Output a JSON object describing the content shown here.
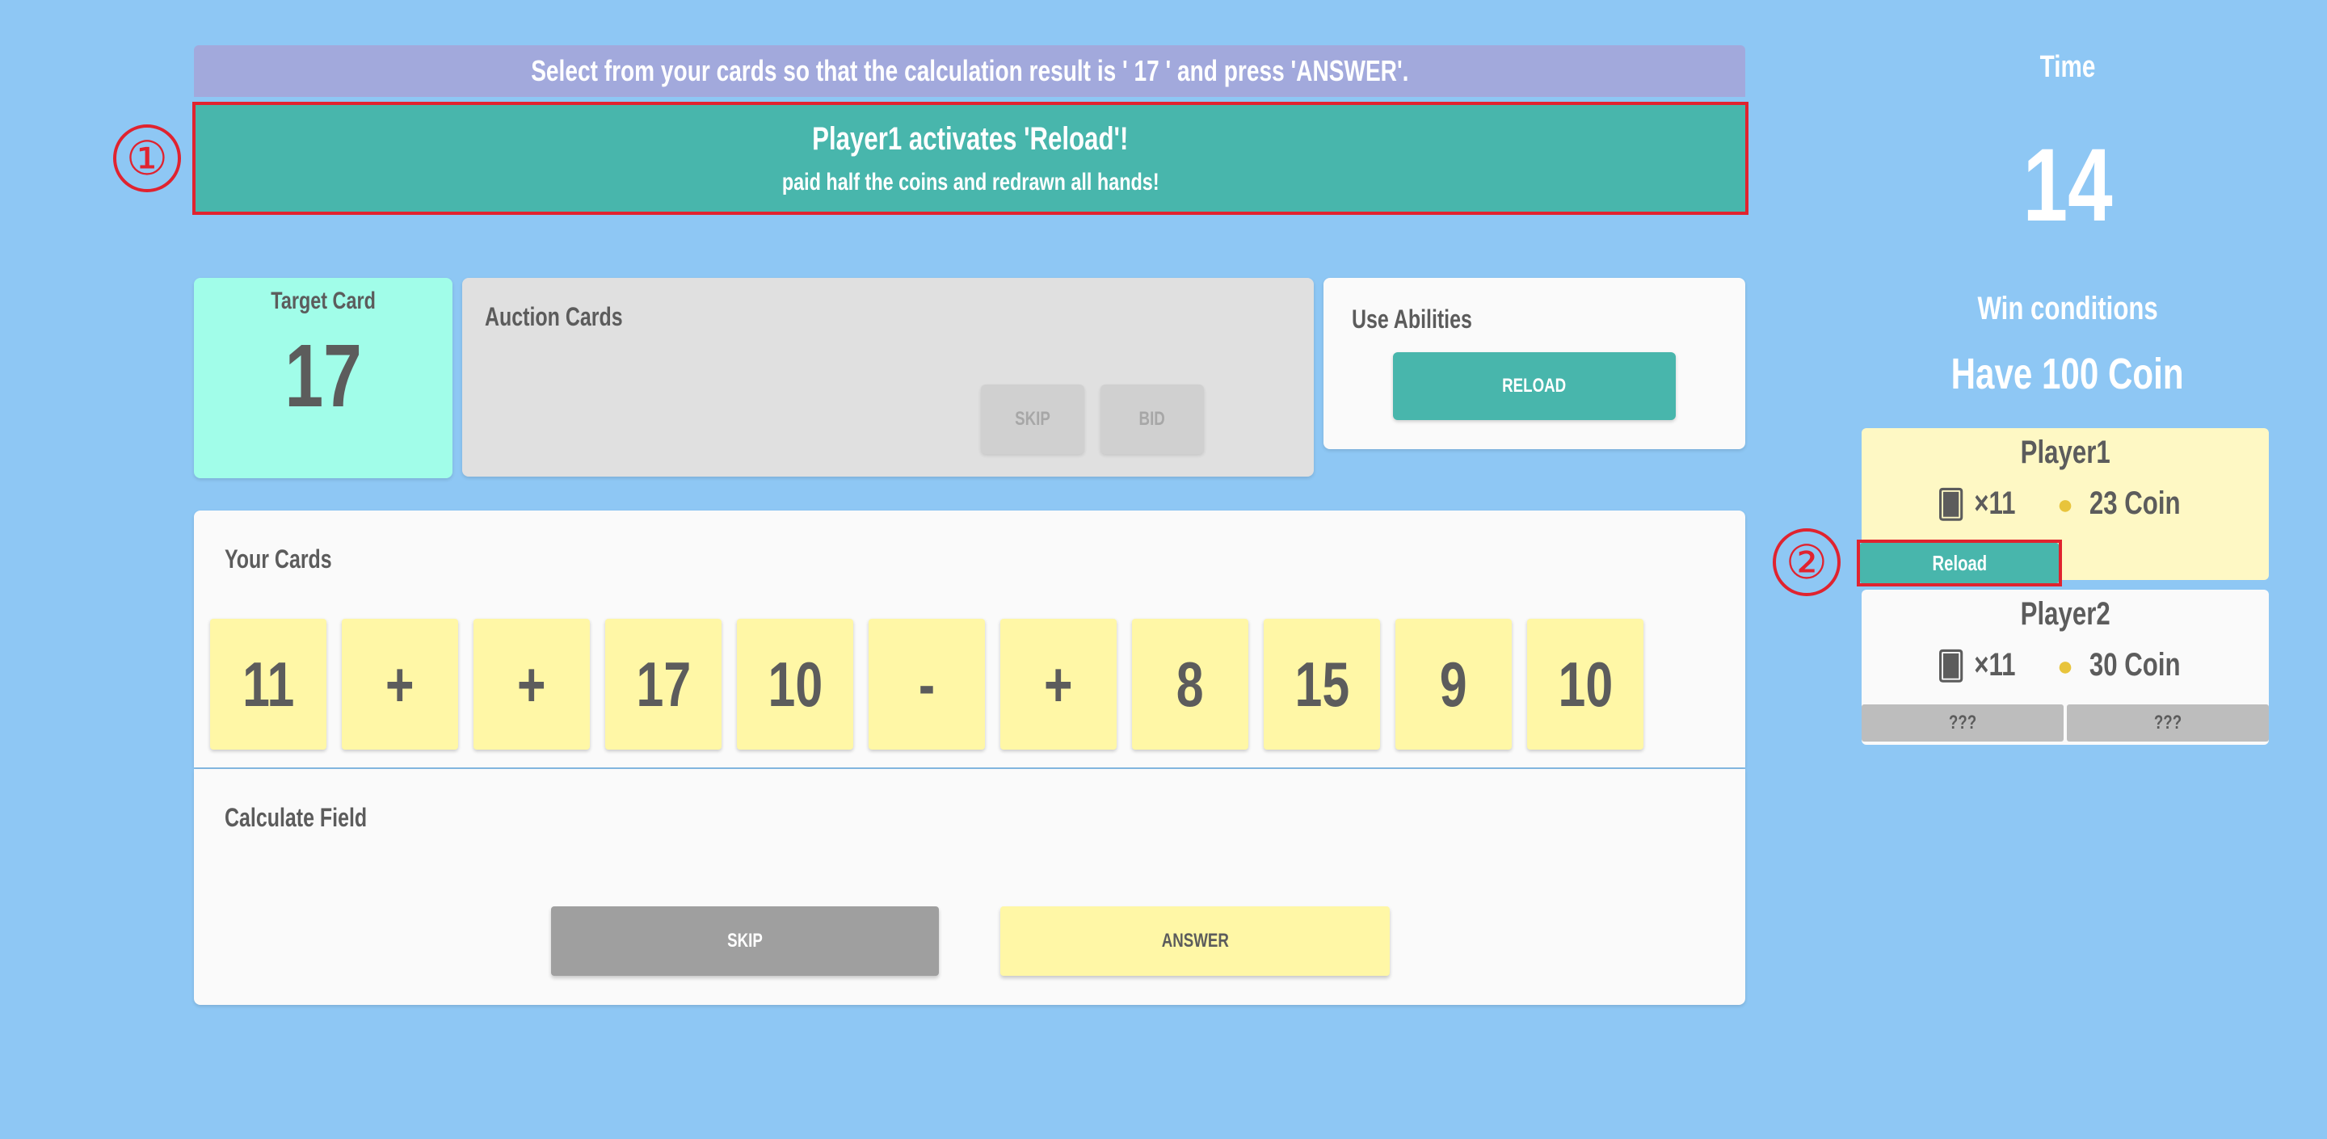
{
  "instruction": "Select from your cards so that the calculation result is ' 17 ' and press 'ANSWER'.",
  "announcement": {
    "line1": "Player1 activates 'Reload'!",
    "line2": "paid half the coins and redrawn all hands!"
  },
  "markers": [
    "①",
    "②"
  ],
  "target_card": {
    "label": "Target Card",
    "value": "17"
  },
  "auction": {
    "label": "Auction Cards",
    "skip": "SKIP",
    "bid": "BID"
  },
  "abilities": {
    "label": "Use Abilities",
    "reload": "RELOAD"
  },
  "your_cards": {
    "label": "Your Cards",
    "cards": [
      "11",
      "+",
      "+",
      "17",
      "10",
      "-",
      "+",
      "8",
      "15",
      "9",
      "10"
    ]
  },
  "calc_field": {
    "label": "Calculate Field",
    "skip": "SKIP",
    "answer": "ANSWER"
  },
  "time": {
    "label": "Time",
    "value": "14"
  },
  "win": {
    "label": "Win conditions",
    "value": "Have 100 Coin"
  },
  "players": [
    {
      "name": "Player1",
      "cards": "×11",
      "coins": "23 Coin",
      "badge": "Reload"
    },
    {
      "name": "Player2",
      "cards": "×11",
      "coins": "30 Coin",
      "hidden": [
        "???",
        "???"
      ]
    }
  ],
  "colors": {
    "background": "#8ec7f4",
    "teal": "#48b6ac",
    "card": "#fff7a6",
    "highlight": "#e0232f"
  },
  "icons": {
    "cards": "playing-cards-icon",
    "coins": "coin-stack-icon"
  }
}
